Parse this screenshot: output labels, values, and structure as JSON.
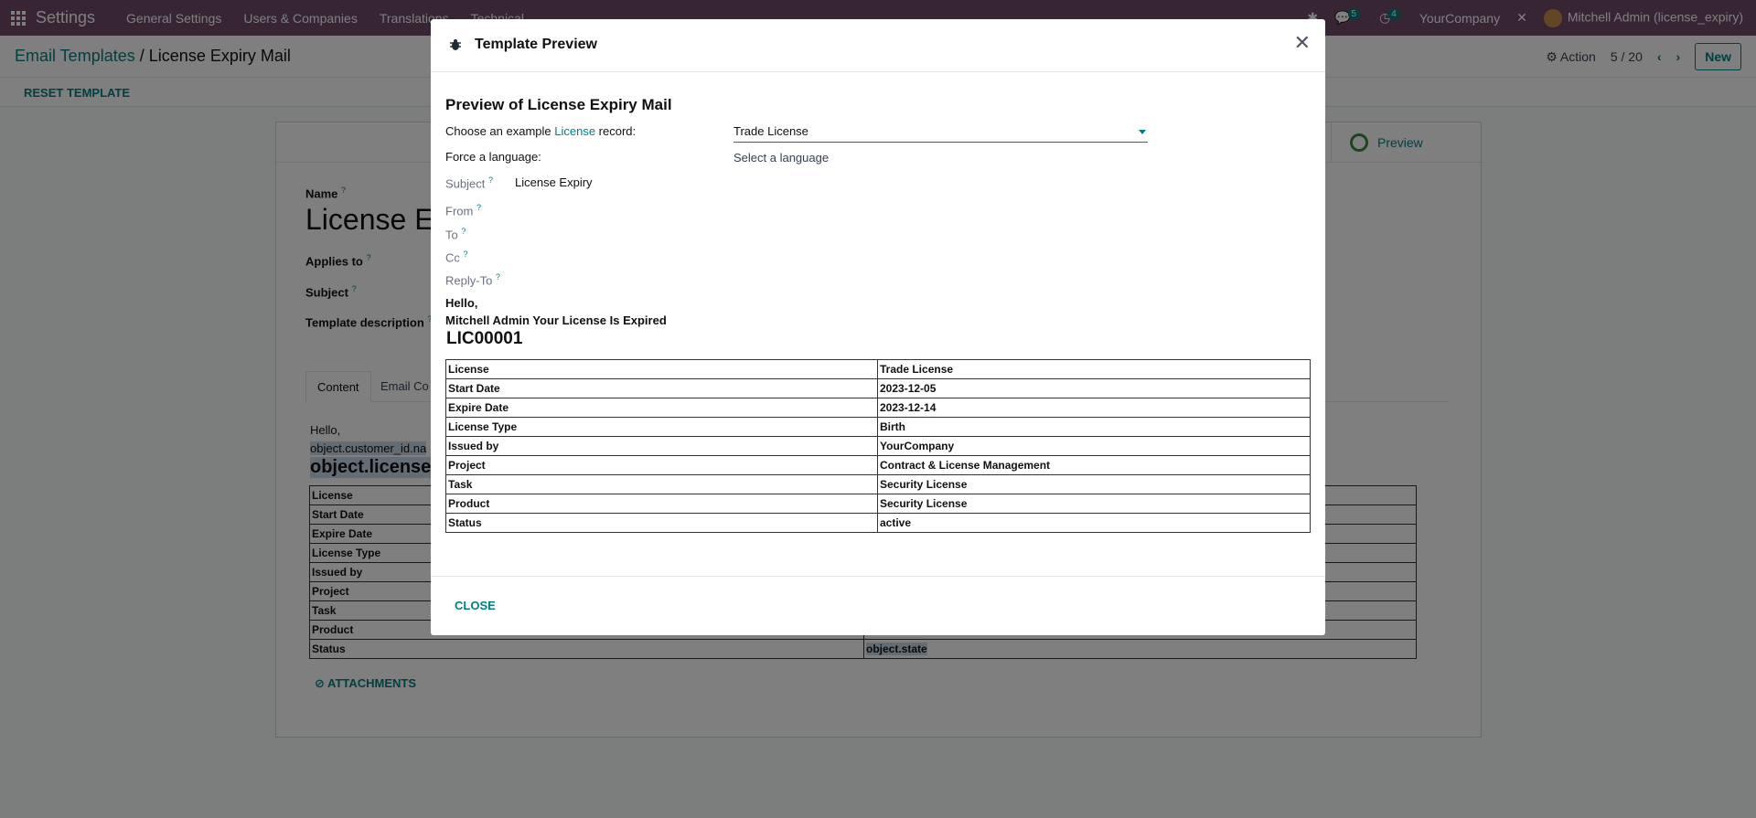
{
  "topnav": {
    "brand": "Settings",
    "menu": [
      "General Settings",
      "Users & Companies",
      "Translations",
      "Technical"
    ],
    "chat_count": "5",
    "activity_count": "4",
    "company": "YourCompany",
    "user": "Mitchell Admin (license_expiry)"
  },
  "control": {
    "breadcrumb_parent": "Email Templates",
    "breadcrumb_sep": "/",
    "breadcrumb_current": "License Expiry Mail",
    "action_label": "Action",
    "pager": "5 / 20",
    "new_label": "New",
    "reset_label": "RESET TEMPLATE"
  },
  "form": {
    "preview_label": "Preview",
    "name_label": "Name",
    "name_value": "License Ex",
    "applies_label": "Applies to",
    "subject_label": "Subject",
    "description_label": "Template description",
    "tabs": [
      "Content",
      "Email Co"
    ],
    "body_hello": "Hello,",
    "body_customer": "object.customer_id.na",
    "body_license": "object.license_",
    "table_labels": [
      "License",
      "Start Date",
      "Expire Date",
      "License Type",
      "Issued by",
      "Project",
      "Task",
      "Product",
      "Status"
    ],
    "status_expr": "object.state",
    "attachments_label": "ATTACHMENTS"
  },
  "modal": {
    "title": "Template Preview",
    "heading": "Preview of License Expiry Mail",
    "choose_prefix": "Choose an example ",
    "choose_link": "License",
    "choose_suffix": " record:",
    "record_value": "Trade License",
    "force_language_label": "Force a language:",
    "language_placeholder": "Select a language",
    "subject_label": "Subject",
    "subject_value": "License Expiry",
    "from_label": "From",
    "to_label": "To",
    "cc_label": "Cc",
    "reply_to_label": "Reply-To",
    "body_hello": "Hello,",
    "body_line": "Mitchell Admin Your License Is Expired",
    "license_no": "LIC00001",
    "rows": [
      {
        "label": "License",
        "value": "Trade License"
      },
      {
        "label": "Start Date",
        "value": "2023-12-05"
      },
      {
        "label": "Expire Date",
        "value": "2023-12-14"
      },
      {
        "label": "License Type",
        "value": "Birth"
      },
      {
        "label": "Issued by",
        "value": "YourCompany"
      },
      {
        "label": "Project",
        "value": "Contract & License Management"
      },
      {
        "label": "Task",
        "value": "Security License"
      },
      {
        "label": "Product",
        "value": "Security License"
      },
      {
        "label": "Status",
        "value": "active"
      }
    ],
    "close_label": "CLOSE"
  },
  "colors": {
    "topbar": "#714b67",
    "accent": "#017e84",
    "backdrop": "rgba(0,0,0,0.5)"
  },
  "icons": [
    "apps-grid-icon",
    "bug-icon",
    "chat-icon",
    "clock-icon",
    "tools-icon",
    "gear-icon",
    "chevron-left-icon",
    "chevron-right-icon",
    "close-icon",
    "search-preview-icon",
    "paperclip-icon",
    "caret-down-icon"
  ]
}
